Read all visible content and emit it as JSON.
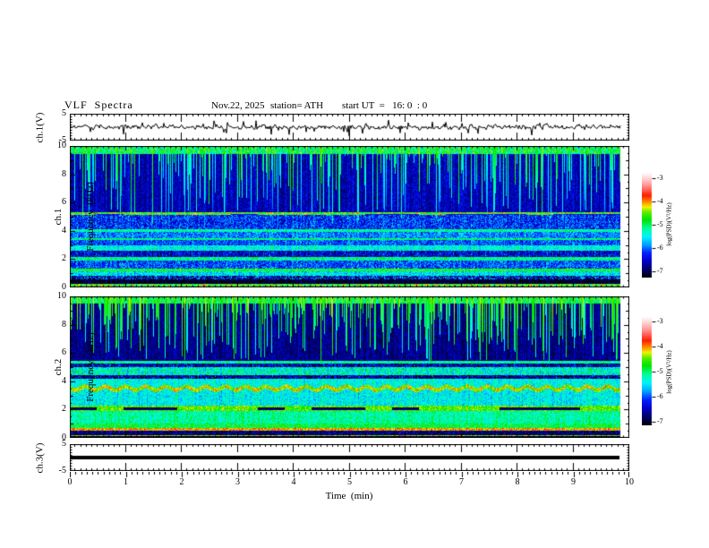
{
  "title": {
    "main": "VLF  Spectra",
    "date": "Nov.22, 2025",
    "station": "station= ATH",
    "start_ut": "start UT  =   16: 0  : 0"
  },
  "x_axis": {
    "label": "Time  (min)",
    "min": 0,
    "max": 10,
    "tick_labels": [
      "0",
      "1",
      "2",
      "3",
      "4",
      "5",
      "6",
      "7",
      "8",
      "9",
      "10"
    ],
    "minor_step": 0.1
  },
  "panels": {
    "wave1": {
      "ylabel": "ch.1(V)",
      "ymin": -5,
      "ymax": 5,
      "tick_labels": [
        "5",
        "-5"
      ]
    },
    "spec1": {
      "ylabel_ch": "ch.1",
      "ylabel_freq": "Frequency  (kHz)",
      "ymin": 0,
      "ymax": 10,
      "tick_labels": [
        "10",
        "8",
        "6",
        "4",
        "2",
        "0"
      ]
    },
    "spec2": {
      "ylabel_ch": "ch.2",
      "ylabel_freq": "Frequency  (kHz)",
      "ymin": 0,
      "ymax": 10,
      "tick_labels": [
        "10",
        "8",
        "6",
        "4",
        "2",
        "0"
      ]
    },
    "wave3": {
      "ylabel": "ch.3(V)",
      "ymin": -5,
      "ymax": 5,
      "tick_labels": [
        "5",
        "-5"
      ]
    }
  },
  "colorbar": {
    "label": "log(PSD)(V²/Hz)",
    "tick_labels": [
      "-3",
      "-4",
      "-5",
      "-6",
      "-7"
    ],
    "zmin": -7,
    "zmax": -3
  },
  "colormap": [
    [
      0,
      "#000000"
    ],
    [
      0.07,
      "#000058"
    ],
    [
      0.16,
      "#0000c8"
    ],
    [
      0.24,
      "#0022ff"
    ],
    [
      0.31,
      "#009cff"
    ],
    [
      0.39,
      "#00f2ff"
    ],
    [
      0.47,
      "#00ff9c"
    ],
    [
      0.55,
      "#00e400"
    ],
    [
      0.62,
      "#55ee00"
    ],
    [
      0.67,
      "#f2f200"
    ],
    [
      0.72,
      "#ff8c00"
    ],
    [
      0.78,
      "#ff1e00"
    ],
    [
      0.86,
      "#ff8080"
    ],
    [
      0.94,
      "#ffd2d2"
    ],
    [
      1,
      "#ffffff"
    ]
  ],
  "chart_data": [
    {
      "panel": "ch.1 time series",
      "type": "line",
      "x_range": [
        0,
        9.84
      ],
      "ylim": [
        -5,
        5
      ],
      "signal": "broadband noise ~±1.5 V about 0 V with impulsive sferic spikes to ±4 V",
      "gen": {
        "seed": 9,
        "noise_amp": 0.9,
        "smooth": 0.35,
        "spike_prob": 0.05,
        "spike_min": 1.2,
        "spike_max": 3.4
      }
    },
    {
      "panel": "ch.1 spectrogram",
      "type": "heatmap",
      "x_range": [
        0,
        9.82
      ],
      "ylim": [
        0,
        10
      ],
      "zlim": [
        -7,
        -3
      ],
      "notes": "dark-blue background above 5.3 kHz crossed by vertical sferic streaks; red transmitter line near 5.2 kHz; layered green/cyan and dark bands below 4 kHz; bright yellow-green band at 0-0.3 kHz",
      "gen": {
        "seed": 11,
        "col_noise": 0.16,
        "fallback": -6.4,
        "bands": [
          {
            "f": [
              0,
              0.28
            ],
            "level": -4.7,
            "var": 0.7
          },
          {
            "f": [
              0.28,
              0.55
            ],
            "level": -6.85,
            "var": 0.25
          },
          {
            "f": [
              0.55,
              0.8
            ],
            "level": -6.3,
            "var": 0.8
          },
          {
            "f": [
              0.8,
              1.15
            ],
            "level": -5.45,
            "var": 0.4
          },
          {
            "f": [
              1.15,
              1.35
            ],
            "level": -4.85,
            "var": 0.35
          },
          {
            "f": [
              1.35,
              1.9
            ],
            "level": -5.95,
            "var": 0.45
          },
          {
            "f": [
              1.9,
              2.15
            ],
            "level": -5.1,
            "var": 0.35
          },
          {
            "f": [
              2.15,
              2.6
            ],
            "level": -6.3,
            "var": 0.5
          },
          {
            "f": [
              2.6,
              3.0
            ],
            "level": -5.35,
            "var": 0.35
          },
          {
            "f": [
              3.0,
              3.35
            ],
            "level": -5.95,
            "var": 0.4
          },
          {
            "f": [
              3.35,
              3.5
            ],
            "level": -5.05,
            "var": 0.3
          },
          {
            "f": [
              3.5,
              3.95
            ],
            "level": -5.8,
            "var": 0.4
          },
          {
            "f": [
              3.95,
              4.1
            ],
            "level": -5.15,
            "var": 0.3
          },
          {
            "f": [
              4.1,
              5.1
            ],
            "level": -6.05,
            "var": 0.45
          },
          {
            "f": [
              5.1,
              5.3
            ],
            "level": -4.6,
            "var": 0.6,
            "dash": true,
            "dash_level": -6.2
          },
          {
            "f": [
              5.3,
              9.45
            ],
            "level": -6.4,
            "var": 0.3
          },
          {
            "f": [
              9.45,
              10.01
            ],
            "level": -5.0,
            "var": 0.6
          }
        ],
        "streaks": {
          "prob": 0.4,
          "bottom_min": 4.3,
          "bottom_max": 9.4,
          "level": -4.9,
          "level_var": 0.5,
          "decay": 0.12
        }
      }
    },
    {
      "panel": "ch.2 spectrogram",
      "type": "heatmap",
      "x_range": [
        0,
        9.82
      ],
      "ylim": [
        0,
        10
      ],
      "zlim": [
        -7,
        -3
      ],
      "notes": "darker blue background above 5.5 kHz with dense green sferic streaks; orange wavy band near 3.5 kHz; dashed yellow band near 2 kHz; strong red band near 0.6 kHz; black base at 0 kHz",
      "gen": {
        "seed": 23,
        "col_noise": 0.16,
        "fallback": -5.4,
        "bands": [
          {
            "f": [
              0,
              0.12
            ],
            "level": -6.9,
            "var": 0.2
          },
          {
            "f": [
              0.12,
              0.2
            ],
            "level": -4.4,
            "var": 0.4
          },
          {
            "f": [
              0.2,
              0.5
            ],
            "level": -6.6,
            "var": 0.5
          },
          {
            "f": [
              0.5,
              0.72
            ],
            "level": -4.15,
            "var": 0.35
          },
          {
            "f": [
              0.72,
              1.0
            ],
            "level": -4.9,
            "var": 0.35
          },
          {
            "f": [
              1.0,
              1.9
            ],
            "level": -5.15,
            "var": 0.3
          },
          {
            "f": [
              1.9,
              2.3
            ],
            "level": -4.6,
            "var": 0.35,
            "dash": true,
            "dash_level": -6.7
          },
          {
            "f": [
              2.3,
              3.35
            ],
            "level": -5.4,
            "var": 0.35
          },
          {
            "f": [
              3.35,
              3.65
            ],
            "level": -4.4,
            "var": 0.35,
            "wavy": true,
            "wavy_amp": 0.12,
            "wavy_freq": 0.28
          },
          {
            "f": [
              3.65,
              4.15
            ],
            "level": -5.35,
            "var": 0.3
          },
          {
            "f": [
              4.15,
              4.45
            ],
            "level": -6.5,
            "var": 0.7
          },
          {
            "f": [
              4.45,
              5.0
            ],
            "level": -5.3,
            "var": 0.5
          },
          {
            "f": [
              5.0,
              5.25
            ],
            "level": -6.4,
            "var": 0.6
          },
          {
            "f": [
              5.25,
              5.45
            ],
            "level": -5.15,
            "var": 0.35
          },
          {
            "f": [
              5.45,
              9.5
            ],
            "level": -6.55,
            "var": 0.28
          },
          {
            "f": [
              9.5,
              10.01
            ],
            "level": -4.95,
            "var": 0.5
          }
        ],
        "streaks": {
          "prob": 0.5,
          "bottom_min": 5.3,
          "bottom_max": 9.3,
          "level": -4.75,
          "level_var": 0.45,
          "decay": 0.1
        }
      }
    },
    {
      "panel": "ch.3 time series",
      "type": "line",
      "x_range": [
        0,
        9.82
      ],
      "ylim": [
        -5,
        5
      ],
      "signal": "flat thick black trace at 0 V (no signal)",
      "flat_value": 0,
      "thickness_px": 4
    }
  ]
}
